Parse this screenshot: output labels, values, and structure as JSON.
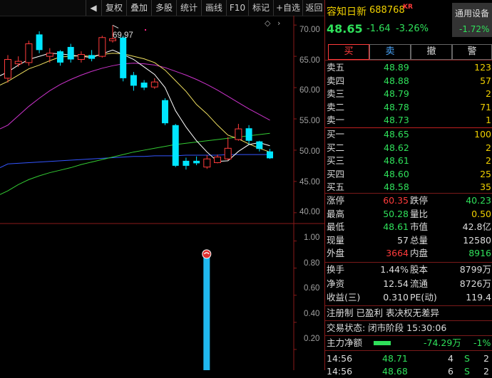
{
  "toolbar": {
    "items": [
      "复权",
      "叠加",
      "多股",
      "统计",
      "画线",
      "F10",
      "标记",
      "+自选",
      "返回"
    ],
    "expand_icon": "chevron-left"
  },
  "chart": {
    "price_ticks": [
      "70.00",
      "65.00",
      "60.00",
      "55.00",
      "50.00",
      "45.00",
      "40.00"
    ],
    "volume_ticks": [
      "1.00",
      "0.80",
      "0.60",
      "0.40",
      "0.20"
    ],
    "high_marker": "69.97",
    "colors": {
      "up": "#ff3b3b",
      "down": "#00e5ff",
      "ma5": "#ffffff",
      "ma10": "#f0e060",
      "ma20": "#cc33cc",
      "ma60": "#33cc33",
      "ma120": "#3355ff",
      "volume": "#20b8f0"
    },
    "candles": [
      {
        "o": 61.5,
        "c": 64.5,
        "h": 65.2,
        "l": 60.8
      },
      {
        "o": 63.8,
        "c": 64.2,
        "h": 65.0,
        "l": 63.3
      },
      {
        "o": 64.0,
        "c": 67.0,
        "h": 67.5,
        "l": 63.5
      },
      {
        "o": 68.5,
        "c": 66.0,
        "h": 69.0,
        "l": 65.5
      },
      {
        "o": 65.0,
        "c": 65.5,
        "h": 66.3,
        "l": 64.0
      },
      {
        "o": 65.8,
        "c": 64.0,
        "h": 66.0,
        "l": 63.5
      },
      {
        "o": 66.5,
        "c": 64.5,
        "h": 67.0,
        "l": 64.0
      },
      {
        "o": 64.5,
        "c": 65.3,
        "h": 65.8,
        "l": 64.0
      },
      {
        "o": 65.2,
        "c": 64.6,
        "h": 66.0,
        "l": 64.2
      },
      {
        "o": 65.0,
        "c": 68.0,
        "h": 68.3,
        "l": 64.8
      },
      {
        "o": 67.5,
        "c": 67.8,
        "h": 69.97,
        "l": 67.2
      },
      {
        "o": 68.0,
        "c": 61.5,
        "h": 68.3,
        "l": 61.0
      },
      {
        "o": 62.0,
        "c": 60.3,
        "h": 62.5,
        "l": 59.5
      },
      {
        "o": 60.8,
        "c": 60.0,
        "h": 61.2,
        "l": 59.6
      },
      {
        "o": 60.1,
        "c": 60.9,
        "h": 61.5,
        "l": 59.8
      },
      {
        "o": 58.0,
        "c": 54.3,
        "h": 58.3,
        "l": 54.0
      },
      {
        "o": 54.0,
        "c": 47.5,
        "h": 54.2,
        "l": 47.3
      },
      {
        "o": 48.3,
        "c": 47.5,
        "h": 48.8,
        "l": 46.9
      },
      {
        "o": 48.3,
        "c": 47.9,
        "h": 49.0,
        "l": 47.6
      },
      {
        "o": 47.3,
        "c": 48.6,
        "h": 49.2,
        "l": 47.0
      },
      {
        "o": 48.0,
        "c": 48.9,
        "h": 49.3,
        "l": 47.9
      },
      {
        "o": 48.6,
        "c": 50.3,
        "h": 52.1,
        "l": 48.4
      },
      {
        "o": 51.7,
        "c": 53.4,
        "h": 54.2,
        "l": 51.5
      },
      {
        "o": 53.5,
        "c": 51.5,
        "h": 54.0,
        "l": 51.0
      },
      {
        "o": 51.4,
        "c": 50.2,
        "h": 51.5,
        "l": 49.8
      },
      {
        "o": 49.8,
        "c": 48.7,
        "h": 50.2,
        "l": 48.6
      }
    ],
    "ma5": [
      62.5,
      63.6,
      64.5,
      65.0,
      65.5,
      65.4,
      65.2,
      65.0,
      64.8,
      65.4,
      66.0,
      65.3,
      64.5,
      63.3,
      62.1,
      60.0,
      56.3,
      53.7,
      51.5,
      49.7,
      48.2,
      48.3,
      49.8,
      50.9,
      51.2,
      50.7
    ],
    "ma10": [
      61.0,
      62.0,
      63.0,
      63.6,
      64.3,
      64.9,
      65.0,
      65.1,
      65.0,
      65.3,
      65.5,
      65.4,
      65.0,
      64.6,
      64.0,
      62.8,
      61.1,
      59.4,
      57.3,
      55.8,
      54.0,
      52.4,
      51.8,
      51.0,
      50.3,
      49.7
    ],
    "ma20": [
      54.0,
      55.5,
      57.0,
      58.3,
      59.5,
      60.5,
      61.3,
      62.0,
      62.6,
      63.1,
      63.5,
      63.8,
      63.9,
      63.8,
      63.6,
      63.2,
      62.6,
      62.0,
      61.3,
      60.5,
      59.6,
      58.6,
      57.6,
      56.6,
      55.7,
      54.8
    ],
    "ma60": [
      43.5,
      44.5,
      45.3,
      45.9,
      46.4,
      46.8,
      47.2,
      47.7,
      48.1,
      48.5,
      48.9,
      49.3,
      49.7,
      50.0,
      50.3,
      50.6,
      50.9,
      51.1,
      51.3,
      51.5,
      51.7,
      51.9,
      52.1,
      52.3,
      52.5,
      52.7
    ],
    "ma120": [
      47.8,
      47.9,
      48.0,
      48.1,
      48.2,
      48.3,
      48.4,
      48.5,
      48.6,
      48.7,
      48.8,
      48.9,
      49.0,
      49.0,
      49.1,
      49.1,
      49.1,
      49.2,
      49.2,
      49.2,
      49.2,
      49.3,
      49.3,
      49.3,
      49.3,
      49.3
    ],
    "volume_bar": 0.93
  },
  "panel": {
    "name": "容知日新",
    "code": "688768",
    "badge": "KR",
    "price": "48.65",
    "change": "-1.64",
    "pct": "-3.26%",
    "sector": "通用设备",
    "sector_pct": "-1.72%",
    "buttons": [
      "买",
      "卖",
      "撤",
      "警"
    ],
    "sells": [
      {
        "label": "卖五",
        "price": "48.89",
        "vol": "123"
      },
      {
        "label": "卖四",
        "price": "48.88",
        "vol": "57"
      },
      {
        "label": "卖三",
        "price": "48.79",
        "vol": "2"
      },
      {
        "label": "卖二",
        "price": "48.78",
        "vol": "71"
      },
      {
        "label": "卖一",
        "price": "48.73",
        "vol": "1"
      }
    ],
    "buys": [
      {
        "label": "买一",
        "price": "48.65",
        "vol": "100"
      },
      {
        "label": "买二",
        "price": "48.62",
        "vol": "2"
      },
      {
        "label": "买三",
        "price": "48.61",
        "vol": "2"
      },
      {
        "label": "买四",
        "price": "48.60",
        "vol": "25"
      },
      {
        "label": "买五",
        "price": "48.58",
        "vol": "35"
      }
    ],
    "stats1": [
      {
        "l1": "涨停",
        "v1": "60.35",
        "c1": "red",
        "l2": "跌停",
        "v2": "40.23",
        "c2": "green"
      },
      {
        "l1": "最高",
        "v1": "50.28",
        "c1": "green",
        "l2": "量比",
        "v2": "0.50",
        "c2": "yel"
      },
      {
        "l1": "最低",
        "v1": "48.61",
        "c1": "green",
        "l2": "市值",
        "v2": "42.8亿",
        "c2": "wht"
      },
      {
        "l1": "现量",
        "v1": "57",
        "c1": "wht",
        "l2": "总量",
        "v2": "12580",
        "c2": "wht"
      },
      {
        "l1": "外盘",
        "v1": "3664",
        "c1": "red",
        "l2": "内盘",
        "v2": "8916",
        "c2": "green"
      }
    ],
    "stats2": [
      {
        "l1": "换手",
        "v1": "1.44%",
        "l2": "股本",
        "v2": "8799万"
      },
      {
        "l1": "净资",
        "v1": "12.54",
        "l2": "流通",
        "v2": "8726万"
      },
      {
        "l1": "收益(三)",
        "v1": "0.310",
        "l2": "PE(动)",
        "v2": "119.4"
      }
    ],
    "notice": "注册制 已盈利 表决权无差异",
    "status": "交易状态: 闭市阶段 15:30:06",
    "capital_label": "主力净额",
    "capital_value": "-74.29万",
    "capital_pct": "-1%",
    "ticks": [
      {
        "time": "14:56",
        "price": "48.71",
        "vol": "4",
        "side": "S",
        "n": "2"
      },
      {
        "time": "14:56",
        "price": "48.68",
        "vol": "6",
        "side": "S",
        "n": "2"
      }
    ]
  }
}
